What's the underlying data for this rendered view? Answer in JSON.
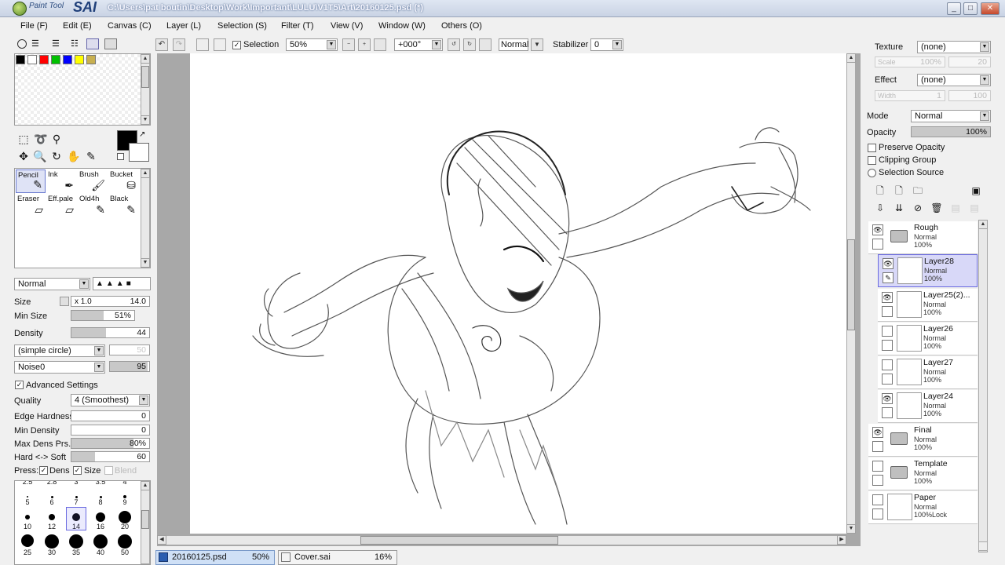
{
  "window": {
    "brand_small": "Paint Tool",
    "brand": "SAI",
    "path": "C:\\Users\\pat boutin\\Desktop\\Work\\Important\\LULU\\V1T5\\Art\\20160125.psd (*)",
    "minimize": "_",
    "maximize": "□",
    "close": "✕"
  },
  "menu": [
    "File (F)",
    "Edit (E)",
    "Canvas (C)",
    "Layer (L)",
    "Selection (S)",
    "Filter (T)",
    "View (V)",
    "Window (W)",
    "Others (O)"
  ],
  "toolbar": {
    "selection_label": "Selection",
    "zoom": "50%",
    "rotation": "+000°",
    "blend": "Normal",
    "stabilizer_label": "Stabilizer",
    "stabilizer_value": "0"
  },
  "colors": {
    "palette": [
      "#000000",
      "#ffffff",
      "#ff0000",
      "#00c000",
      "#0000ff",
      "#ffff00",
      "#c8b050"
    ],
    "primary": "#000000",
    "secondary": "#ffffff"
  },
  "brushes": [
    {
      "name": "Pencil",
      "icon": "✎"
    },
    {
      "name": "Ink",
      "icon": "✒"
    },
    {
      "name": "Brush",
      "icon": "🖌"
    },
    {
      "name": "Bucket",
      "icon": "⛁"
    },
    {
      "name": "Eraser",
      "icon": "▱"
    },
    {
      "name": "Eff.pale",
      "icon": "▱"
    },
    {
      "name": "Old4h",
      "icon": "✎"
    },
    {
      "name": "Black",
      "icon": "✎"
    }
  ],
  "brush_settings": {
    "mode": "Normal",
    "size_label": "Size",
    "size_mult": "x 1.0",
    "size_value": "14.0",
    "min_size_label": "Min Size",
    "min_size_value": "51%",
    "density_label": "Density",
    "density_value": "44",
    "shape": "(simple circle)",
    "shape_value": "50",
    "texture": "Noise0",
    "texture_value": "95",
    "advanced_label": "Advanced Settings",
    "quality_label": "Quality",
    "quality_value": "4 (Smoothest)",
    "edge_label": "Edge Hardness",
    "edge_value": "0",
    "min_density_label": "Min Density",
    "min_density_value": "0",
    "max_dens_label": "Max Dens Prs.",
    "max_dens_value": "80%",
    "hard_soft_label": "Hard <-> Soft",
    "hard_soft_value": "60",
    "press_label": "Press:",
    "dens_label": "Dens",
    "size_chk_label": "Size",
    "blend_label": "Blend"
  },
  "brush_sizes": {
    "partial_top": [
      "2.5",
      "2.8",
      "3",
      "3.5",
      "4"
    ],
    "row1": [
      "5",
      "6",
      "7",
      "8",
      "9"
    ],
    "row2": [
      "10",
      "12",
      "14",
      "16",
      "20"
    ],
    "row3": [
      "25",
      "30",
      "35",
      "40",
      "50"
    ],
    "selected": "14"
  },
  "right_panel": {
    "texture_label": "Texture",
    "texture_value": "(none)",
    "scale_label": "Scale",
    "scale_value": "100%",
    "scale_num": "20",
    "effect_label": "Effect",
    "effect_value": "(none)",
    "width_label": "Width",
    "width_value": "1",
    "width_num": "100",
    "mode_label": "Mode",
    "mode_value": "Normal",
    "opacity_label": "Opacity",
    "opacity_value": "100%",
    "opacity_fraction": 1.0,
    "preserve_opacity": "Preserve Opacity",
    "clipping_group": "Clipping Group",
    "selection_source": "Selection Source"
  },
  "layers": [
    {
      "name": "Rough",
      "mode": "Normal",
      "opacity": "100%",
      "type": "folder",
      "visible": true
    },
    {
      "name": "Layer28",
      "mode": "Normal",
      "opacity": "100%",
      "type": "layer",
      "visible": true,
      "selected": true
    },
    {
      "name": "Layer25(2)...",
      "mode": "Normal",
      "opacity": "100%",
      "type": "layer",
      "visible": true
    },
    {
      "name": "Layer26",
      "mode": "Normal",
      "opacity": "100%",
      "type": "layer",
      "visible": false
    },
    {
      "name": "Layer27",
      "mode": "Normal",
      "opacity": "100%",
      "type": "layer",
      "visible": false
    },
    {
      "name": "Layer24",
      "mode": "Normal",
      "opacity": "100%",
      "type": "layer",
      "visible": true
    },
    {
      "name": "Final",
      "mode": "Normal",
      "opacity": "100%",
      "type": "folder",
      "visible": true
    },
    {
      "name": "Template",
      "mode": "Normal",
      "opacity": "100%",
      "type": "folder",
      "visible": false
    },
    {
      "name": "Paper",
      "mode": "Normal",
      "opacity": "100%",
      "type": "paper",
      "visible": false,
      "lock": "Lock"
    }
  ],
  "tabs": [
    {
      "name": "20160125.psd",
      "zoom": "50%",
      "active": true
    },
    {
      "name": "Cover.sai",
      "zoom": "16%",
      "active": false
    }
  ]
}
